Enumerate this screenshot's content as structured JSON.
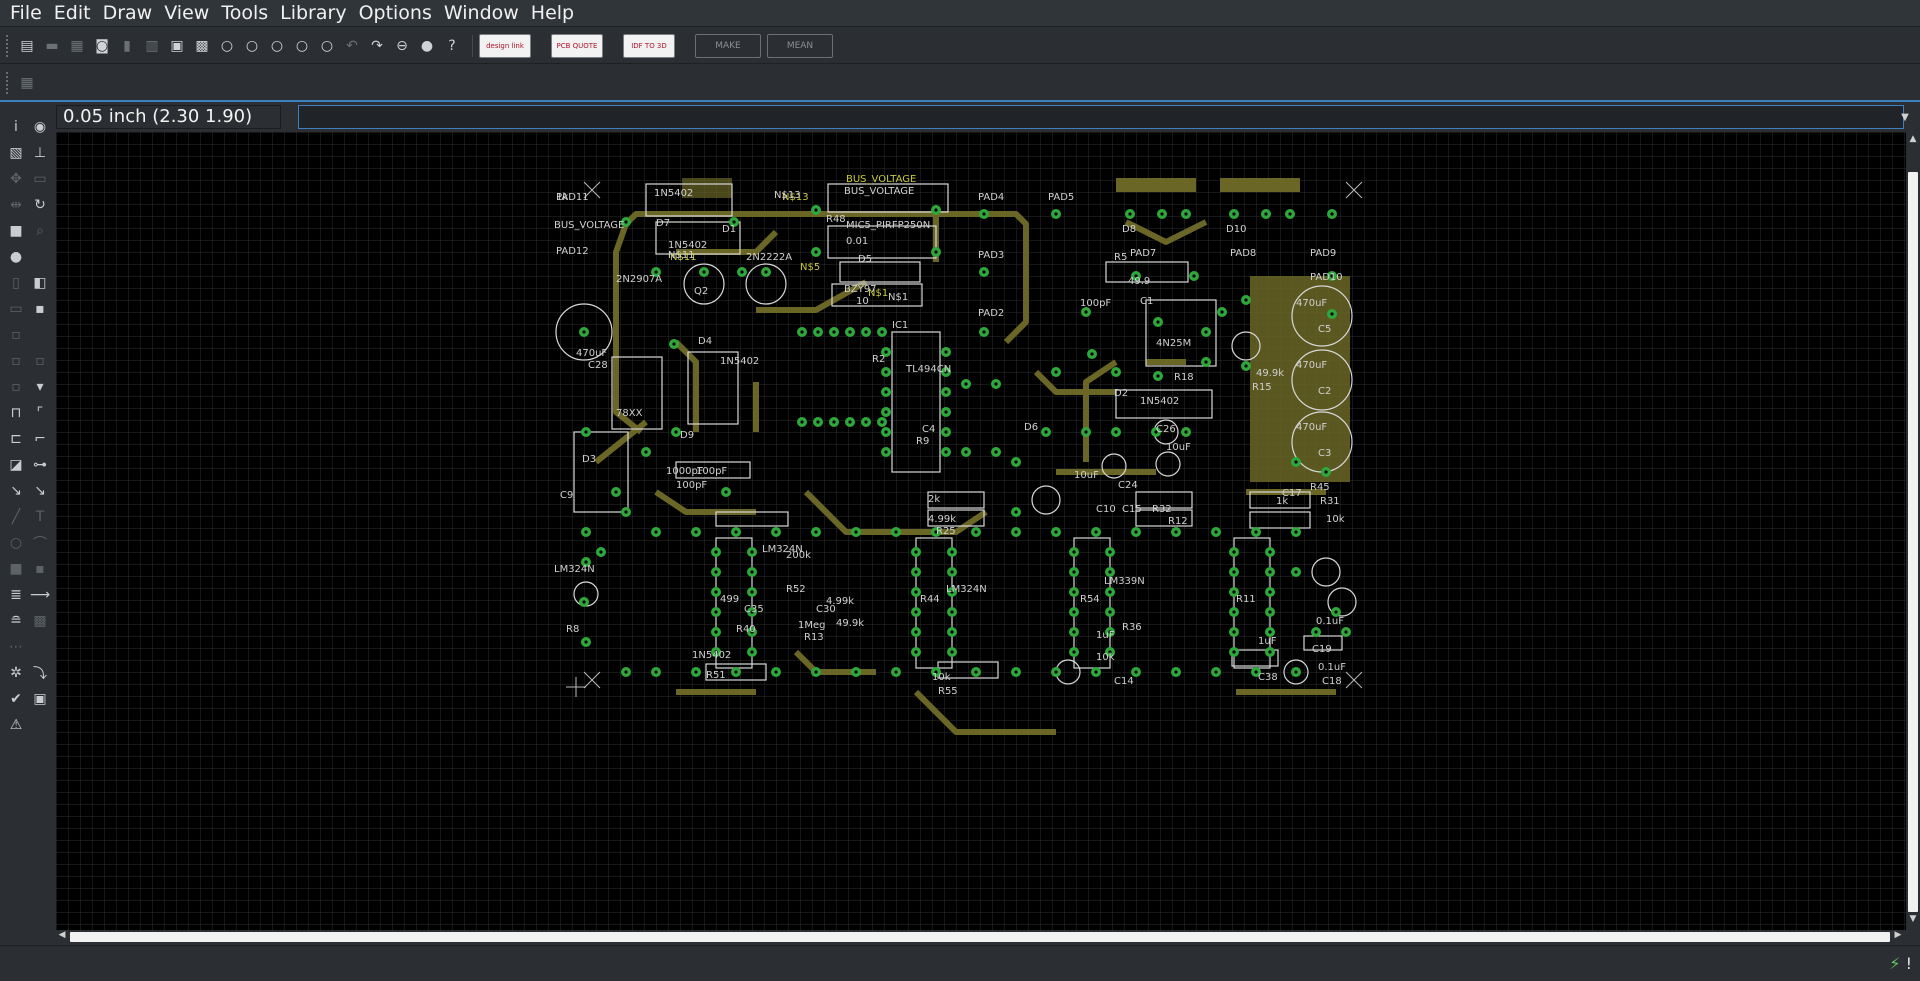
{
  "menubar": {
    "items": [
      {
        "label": "File"
      },
      {
        "label": "Edit"
      },
      {
        "label": "Draw"
      },
      {
        "label": "View"
      },
      {
        "label": "Tools"
      },
      {
        "label": "Library"
      },
      {
        "label": "Options"
      },
      {
        "label": "Window"
      },
      {
        "label": "Help"
      }
    ]
  },
  "toolbar": {
    "help_label": "?",
    "design_link": "design link",
    "pcb_quote": "PCB QUOTE",
    "idf": "IDF TO 3D",
    "make": "MAKE",
    "mean": "MEAN"
  },
  "coordinates": {
    "value": "0.05 inch (2.30 1.90)"
  },
  "command": {
    "value": ""
  },
  "status": {
    "text": "",
    "icons": [
      "lightning-icon",
      "alert-icon"
    ]
  },
  "colors": {
    "canvas_bg": "#000000",
    "grid": "#2a2a2a",
    "copper": "#6a6626",
    "pad": "#2ea83a",
    "silk": "#d8d8d8",
    "name_text": "#c8c83c",
    "accent": "#3d7fbf"
  },
  "board": {
    "labels": [
      "PAD11",
      "PAD12",
      "BUS_VOLTAGE",
      "1N5402",
      "D7",
      "D1",
      "N$13",
      "N$11",
      "1N5402",
      "2N2907A",
      "Q2",
      "2N2222A",
      "BUS_VOLTAGE",
      "R48",
      "MIC5_PIRFP250N",
      "0.01",
      "D5",
      "BZY97",
      "10",
      "N$1",
      "PAD4",
      "PAD5",
      "D8",
      "D10",
      "PAD3",
      "PAD2",
      "PAD7",
      "PAD8",
      "PAD9",
      "PAD10",
      "R5",
      "49.9",
      "100pF",
      "C1",
      "4N25M",
      "R18",
      "C28",
      "470uF",
      "IC1",
      "TL494CN",
      "D4",
      "1N5402",
      "78XX",
      "D9",
      "D6",
      "D2",
      "1N5402",
      "R15",
      "49.9k",
      "470uF",
      "C5",
      "470uF",
      "C2",
      "470uF",
      "C3",
      "C26",
      "10uF",
      "10uF",
      "C24",
      "C10",
      "C15",
      "R32",
      "R12",
      "2k",
      "4.99k",
      "R25",
      "1k",
      "C17",
      "R45",
      "10k",
      "R31",
      "499",
      "LM324N",
      "200k",
      "R52",
      "R44",
      "LM324N",
      "R54",
      "LM339N",
      "R11",
      "LM324N",
      "C9",
      "D3",
      "1N5402",
      "R51",
      "10k",
      "R55",
      "10k",
      "C14",
      "1uF",
      "C38",
      "0.1uF",
      "C19",
      "0.1uF",
      "C18",
      "1uF",
      "R36",
      "R8",
      "R40",
      "C35",
      "C30",
      "1000pF",
      "100pF",
      "100pF",
      "C4",
      "R2",
      "R9",
      "R13",
      "49.9k",
      "1Meg",
      "4.99k",
      "1k"
    ]
  }
}
